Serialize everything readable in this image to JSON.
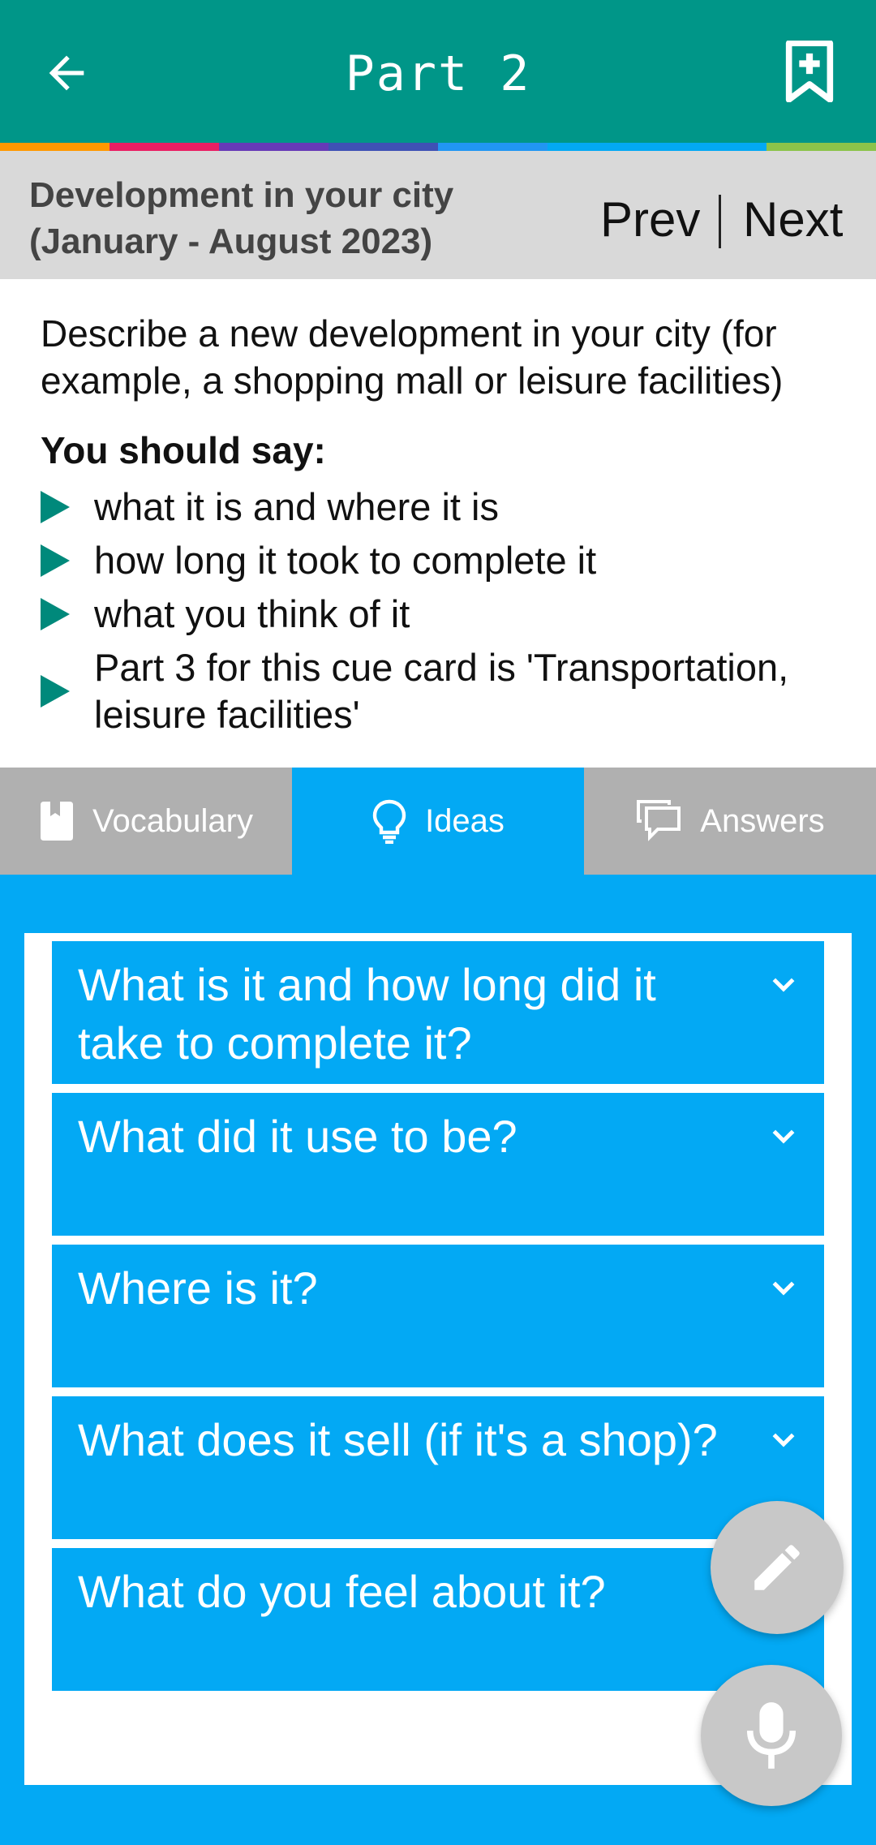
{
  "app_bar": {
    "title": "Part 2",
    "back_icon": "arrow-left-icon",
    "bookmark_icon": "bookmark-add-icon"
  },
  "stripe_colors": [
    "#ff9800",
    "#e91e63",
    "#673ab7",
    "#3f51b5",
    "#2196f3",
    "#03a9f4",
    "#03a9f4",
    "#8bc34a"
  ],
  "header": {
    "topic_line1": "Development in your city",
    "topic_line2": "(January - August 2023)",
    "prev_label": "Prev",
    "next_label": "Next"
  },
  "cue_card": {
    "description": "Describe a new development in your city (for example, a shopping mall or leisure facilities)",
    "should_say_label": "You should say:",
    "points": [
      "what it is and where it is",
      "how long it took to complete it",
      "what you think of it",
      "Part 3 for this cue card is 'Transportation, leisure facilities'"
    ]
  },
  "tabs": [
    {
      "label": "Vocabulary",
      "icon": "book-icon",
      "active": false
    },
    {
      "label": "Ideas",
      "icon": "lightbulb-icon",
      "active": true
    },
    {
      "label": "Answers",
      "icon": "chat-bubbles-icon",
      "active": false
    }
  ],
  "questions": [
    "What is it and how long did it take to complete it?",
    "What did it use to be?",
    "Where is it?",
    "What does it sell (if it's a shop)?",
    "What do you feel about it?"
  ],
  "fabs": {
    "edit_icon": "pencil-icon",
    "mic_icon": "microphone-icon"
  },
  "colors": {
    "app_bar": "#009688",
    "accent_blue": "#03a9f4",
    "bullet_green": "#00897b",
    "header_gray": "#d9d9d9",
    "tab_inactive": "#b0b0b0",
    "fab_gray": "#c8c8c8"
  }
}
